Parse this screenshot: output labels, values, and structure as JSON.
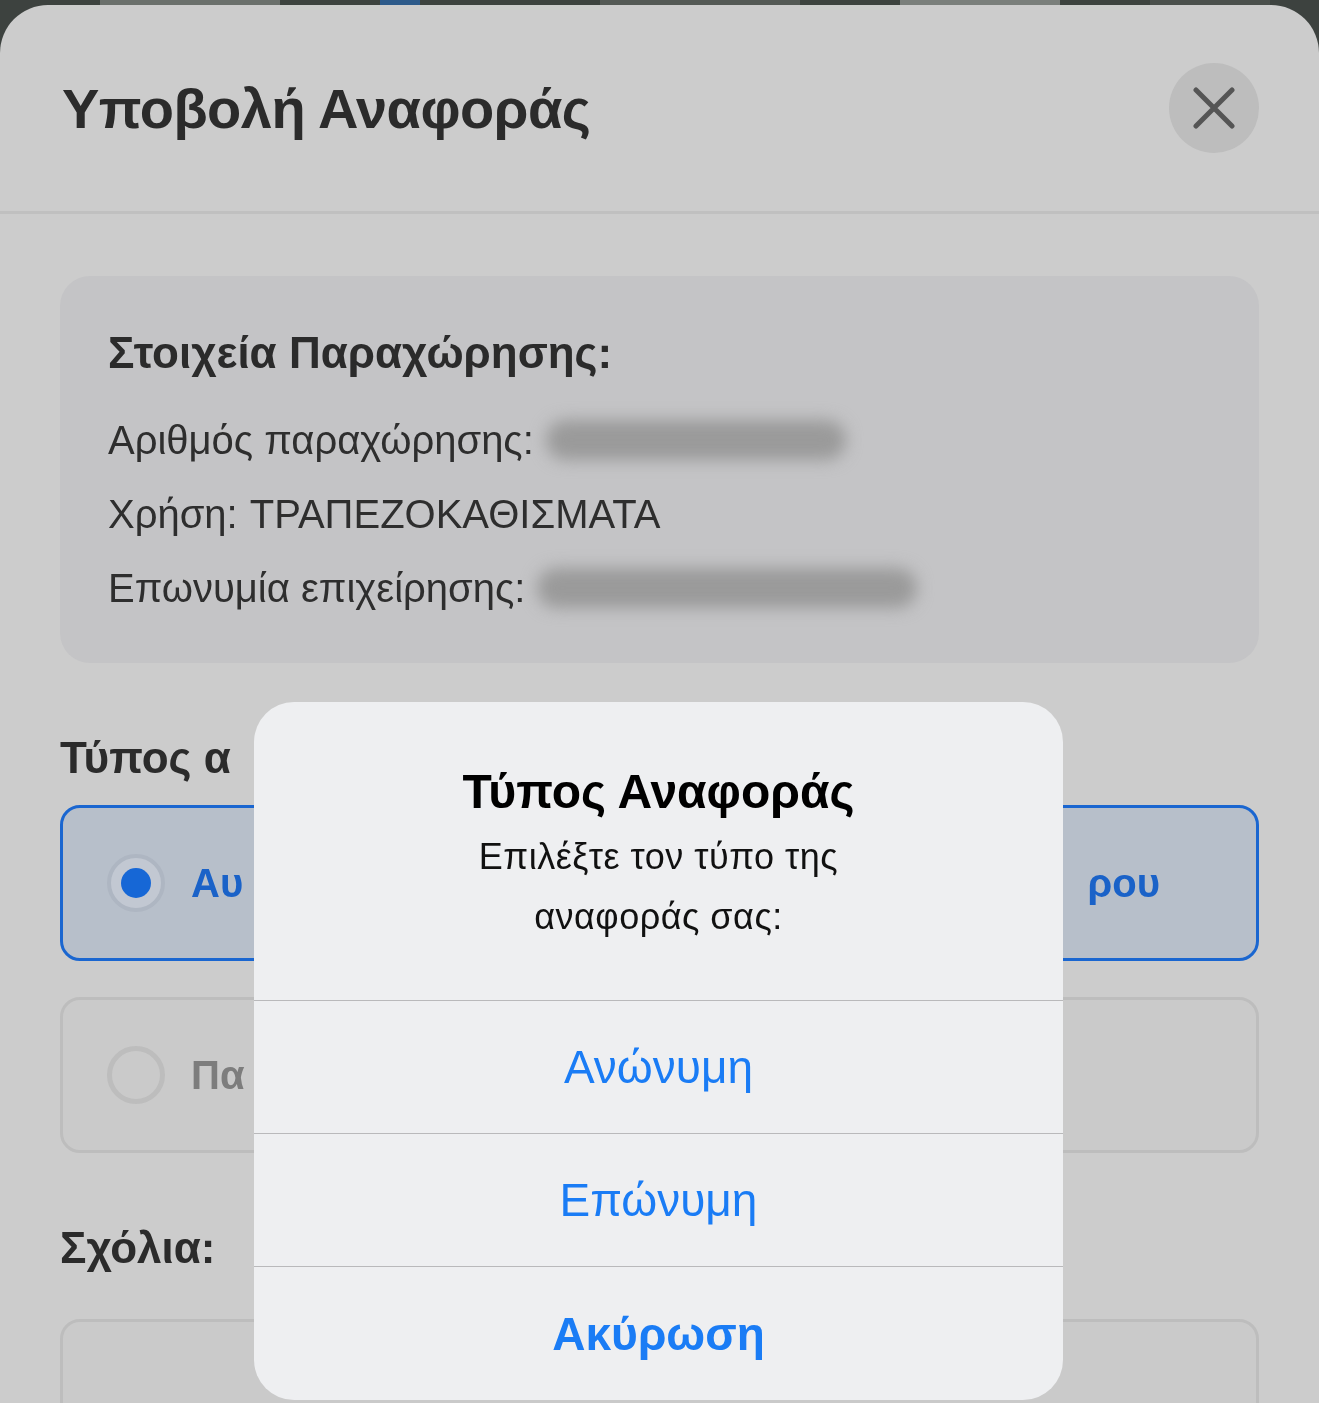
{
  "sheet": {
    "title": "Υποβολή Αναφοράς"
  },
  "details": {
    "heading": "Στοιχεία Παραχώρησης:",
    "rows": [
      {
        "label": "Αριθμός παραχώρησης:",
        "redacted": true
      },
      {
        "label": "Χρήση:",
        "value": "ΤΡΑΠΕΖΟΚΑΘΙΣΜΑΤΑ",
        "redacted": false
      },
      {
        "label": "Επωνυμία επιχείρησης:",
        "redacted": true
      }
    ]
  },
  "report_type": {
    "heading": "Τύπος α",
    "options": [
      {
        "label_start": "Αυ",
        "label_end": "ρου",
        "selected": true
      },
      {
        "label_start": "Πα",
        "selected": false
      }
    ]
  },
  "comments": {
    "heading": "Σχόλια:"
  },
  "dialog": {
    "title": "Τύπος Αναφοράς",
    "message": "Επιλέξτε τον τύπο της αναφοράς σας:",
    "actions": [
      {
        "label": "Ανώνυμη",
        "kind": "default"
      },
      {
        "label": "Επώνυμη",
        "kind": "default"
      },
      {
        "label": "Ακύρωση",
        "kind": "cancel"
      }
    ]
  }
}
